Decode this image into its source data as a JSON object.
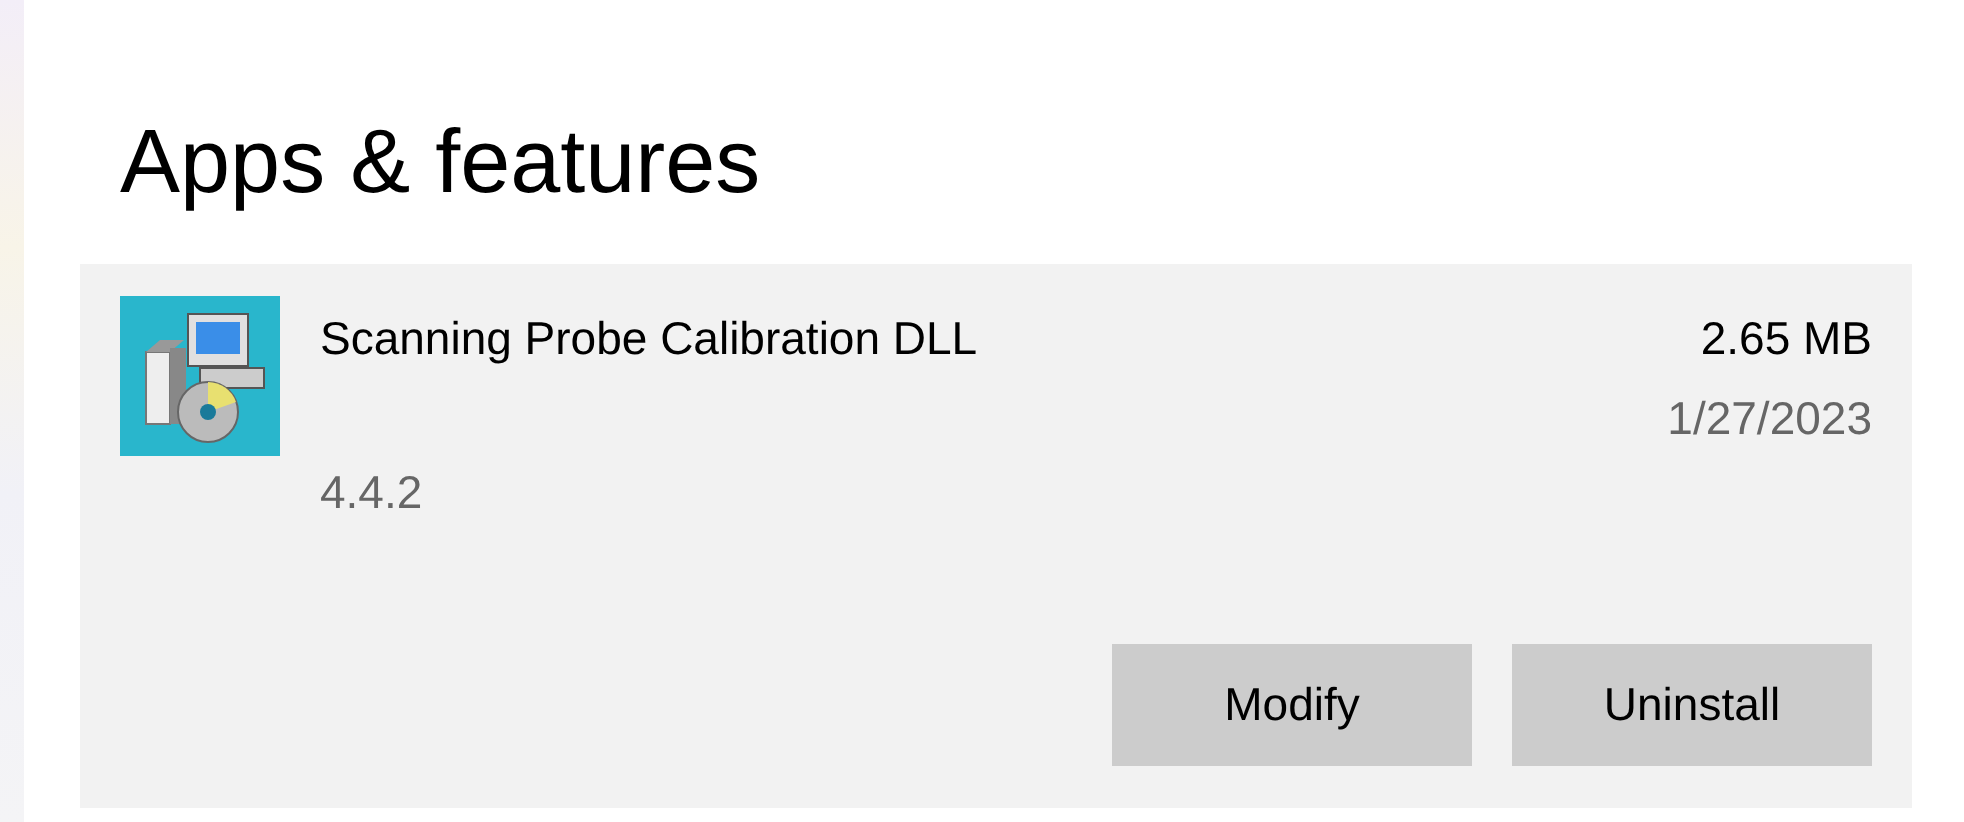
{
  "title": "Apps & features",
  "app": {
    "name": "Scanning Probe Calibration DLL",
    "size": "2.65 MB",
    "date": "1/27/2023",
    "version": "4.4.2",
    "selected": true
  },
  "buttons": [
    {
      "label": "Modify"
    },
    {
      "label": "Uninstall"
    }
  ]
}
